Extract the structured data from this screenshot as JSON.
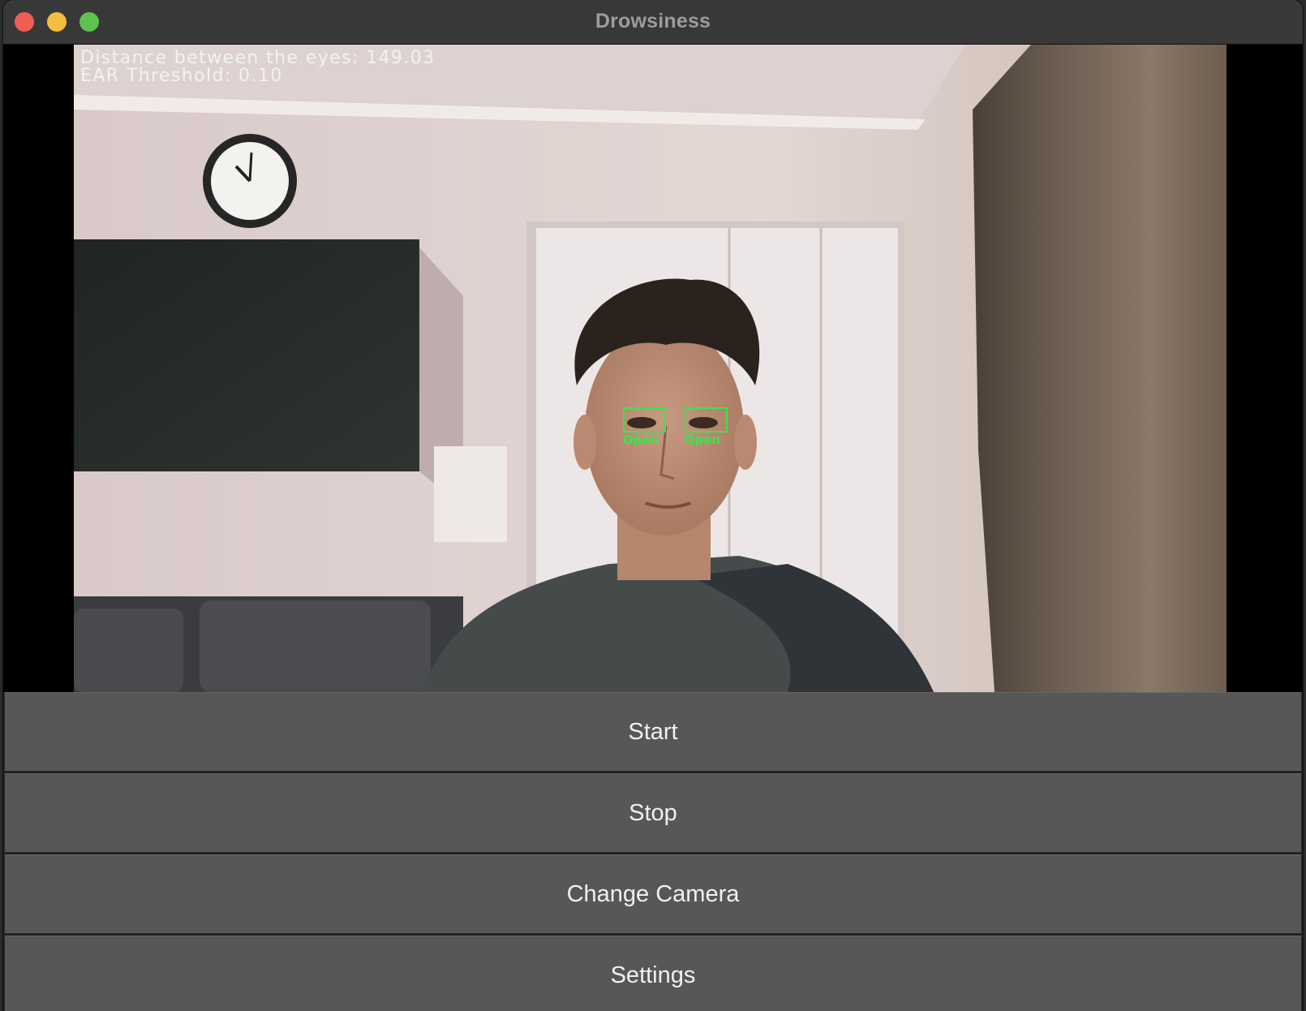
{
  "window": {
    "title": "Drowsiness"
  },
  "overlay": {
    "distance_text": "Distance between the eyes: 149.03",
    "ear_text": "EAR Threshold: 0.10"
  },
  "eyes": [
    {
      "label": "Open"
    },
    {
      "label": "Open"
    }
  ],
  "controls": {
    "start_label": "Start",
    "stop_label": "Stop",
    "change_camera_label": "Change Camera",
    "settings_label": "Settings"
  }
}
